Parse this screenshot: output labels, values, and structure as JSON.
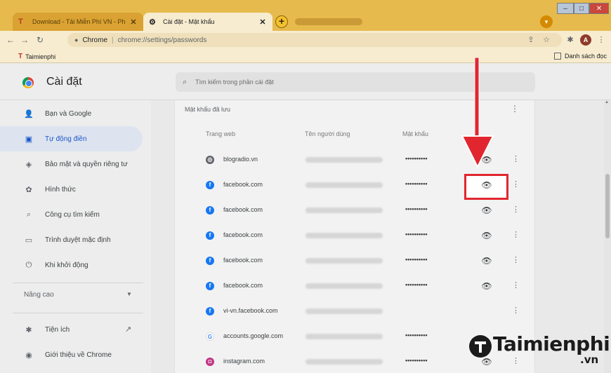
{
  "tabs": [
    {
      "title": "Download - Tải Miễn Phí VN - Ph",
      "favicon": "T",
      "close": "✕"
    },
    {
      "title": "Cài đặt - Mật khẩu",
      "favicon": "⚙",
      "close": "✕"
    }
  ],
  "new_tab_label": "+",
  "toolbar": {
    "site_chip": "Chrome",
    "url": "chrome://settings/passwords",
    "profile_initial": "A"
  },
  "bookmarks": {
    "item": "Taimienphi",
    "reading_list": "Danh sách đọc"
  },
  "settings": {
    "title": "Cài đặt",
    "search_placeholder": "Tìm kiếm trong phần cài đặt"
  },
  "sidebar": {
    "items": [
      {
        "label": "Bạn và Google",
        "icon": "person-icon"
      },
      {
        "label": "Tự động điền",
        "icon": "clipboard-icon",
        "active": true
      },
      {
        "label": "Bảo mật và quyền riêng tư",
        "icon": "shield-icon"
      },
      {
        "label": "Hình thức",
        "icon": "palette-icon"
      },
      {
        "label": "Công cụ tìm kiếm",
        "icon": "search-icon"
      },
      {
        "label": "Trình duyệt mặc định",
        "icon": "browser-icon"
      },
      {
        "label": "Khi khởi động",
        "icon": "power-icon"
      }
    ],
    "advanced": "Nâng cao",
    "extensions": "Tiện ích",
    "about": "Giới thiệu về Chrome"
  },
  "passwords": {
    "section_title": "Mật khẩu đã lưu",
    "columns": {
      "site": "Trang web",
      "user": "Tên người dùng",
      "password": "Mật khẩu"
    },
    "rows": [
      {
        "site": "blogradio.vn",
        "icon": "globe-icon",
        "password": "••••••••••"
      },
      {
        "site": "facebook.com",
        "icon": "facebook-icon",
        "password": "••••••••••"
      },
      {
        "site": "facebook.com",
        "icon": "facebook-icon",
        "password": "••••••••••"
      },
      {
        "site": "facebook.com",
        "icon": "facebook-icon",
        "password": "••••••••••"
      },
      {
        "site": "facebook.com",
        "icon": "facebook-icon",
        "password": "••••••••••"
      },
      {
        "site": "facebook.com",
        "icon": "facebook-icon",
        "password": "••••••••••"
      },
      {
        "site": "vi-vn.facebook.com",
        "icon": "facebook-icon",
        "password": ""
      },
      {
        "site": "accounts.google.com",
        "icon": "google-icon",
        "password": "••••••••••"
      },
      {
        "site": "instagram.com",
        "icon": "instagram-icon",
        "password": "••••••••••"
      }
    ]
  },
  "colors": {
    "tab_strip": "#e6ba4d",
    "active_nav": "#1a56c8",
    "highlight": "#e2262f",
    "facebook": "#1877f2"
  },
  "watermark": {
    "text": "Taimienphi",
    "suffix": ".vn"
  }
}
